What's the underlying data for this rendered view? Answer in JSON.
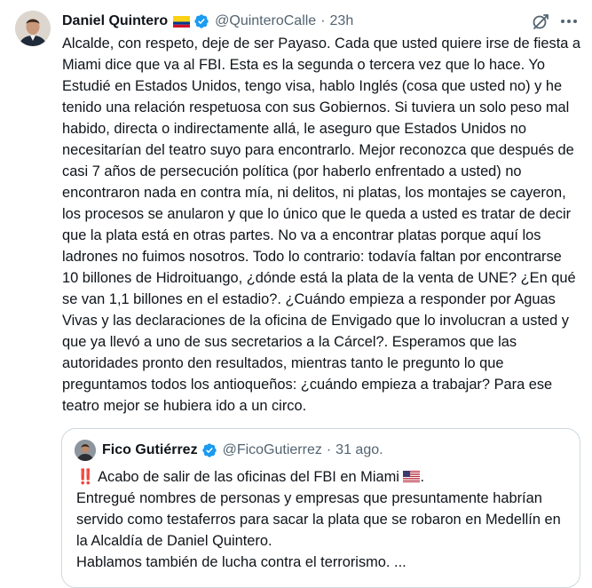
{
  "tweet": {
    "author_name": "Daniel Quintero",
    "handle": "@QuinteroCalle",
    "separator": "·",
    "time": "23h",
    "body": "Alcalde, con respeto, deje de ser Payaso. Cada que usted quiere irse de fiesta a Miami dice que va al FBI. Esta es la segunda o tercera vez que lo hace. Yo Estudié en Estados Unidos, tengo visa, hablo Inglés (cosa que usted no) y he tenido una relación respetuosa con sus Gobiernos. Si tuviera un solo peso mal habido, directa o indirectamente allá, le aseguro que Estados Unidos no necesitarían del teatro suyo para encontrarlo. Mejor reconozca que después de casi 7 años de persecución política (por haberlo enfrentado a usted) no encontraron nada en contra mía, ni delitos, ni platas, los montajes se cayeron, los procesos se anularon y que lo único que le queda a usted es tratar de decir que la plata está en otras partes. No va a encontrar platas porque aquí los ladrones no fuimos nosotros. Todo lo contrario: todavía faltan por encontrarse 10 billones de Hidroituango, ¿dónde está la plata de la venta de UNE? ¿En qué se van 1,1 billones en el estadio?. ¿Cuándo empieza a responder por Aguas Vivas y las declaraciones de la oficina de Envigado que lo involucran a usted y que ya llevó a uno de sus secretarios a la Cárcel?. Esperamos que las autoridades pronto den resultados, mientras tanto le pregunto lo que preguntamos todos los antioqueños: ¿cuándo empieza a trabajar? Para ese teatro mejor se hubiera ido a un circo."
  },
  "quoted_tweet": {
    "author_name": "Fico Gutiérrez",
    "handle": "@FicoGutierrez",
    "separator": "·",
    "time": "31 ago.",
    "emphasis": "‼️",
    "line1": "Acabo de salir de las oficinas del FBI en Miami",
    "body": "Entregué nombres de personas y empresas que presuntamente habrían servido como testaferros para sacar la plata que se robaron en Medellín en la Alcaldía de Daniel Quintero.\nHablamos también de lucha contra el terrorismo. ..."
  },
  "icons": {
    "author_flag": "colombia-flag-icon",
    "verified": "verified-badge-icon",
    "grok": "grok-icon",
    "more": "more-options-icon",
    "us_flag": "us-flag-icon"
  },
  "colors": {
    "text": "#0f1419",
    "secondary_text": "#536471",
    "verified_blue": "#1d9bf0",
    "border": "#cfd9de"
  }
}
